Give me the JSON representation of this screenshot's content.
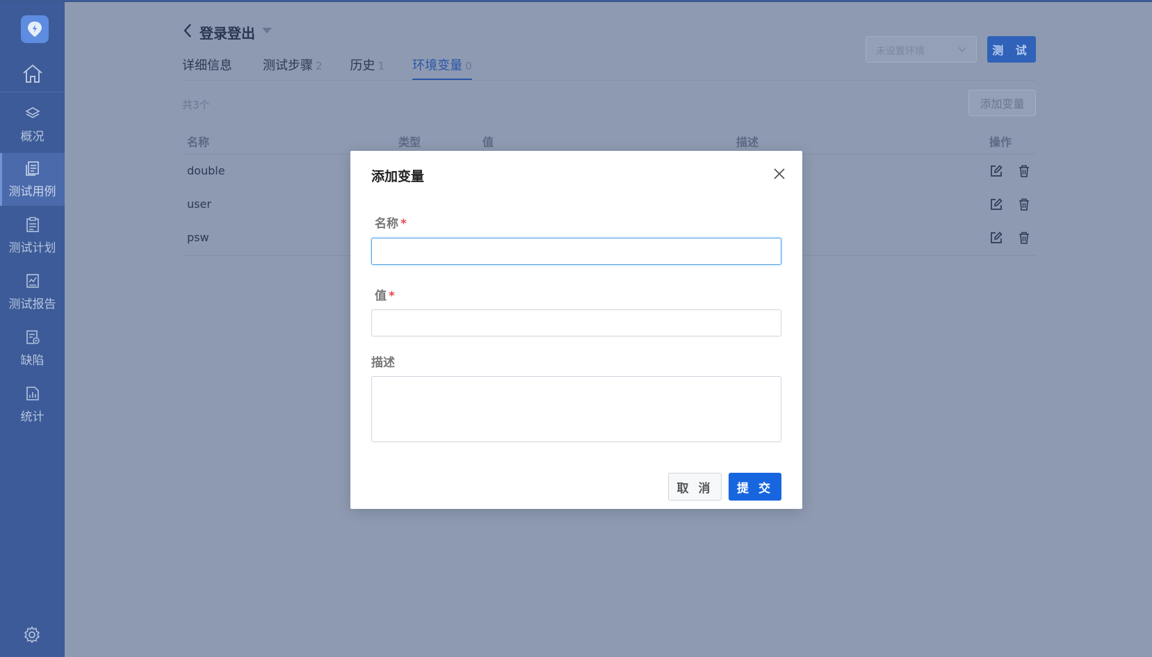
{
  "sidebar": {
    "items": [
      {
        "label": "概况",
        "icon": "layers-icon"
      },
      {
        "label": "测试用例",
        "icon": "document-list-icon",
        "active": true
      },
      {
        "label": "测试计划",
        "icon": "clipboard-icon"
      },
      {
        "label": "测试报告",
        "icon": "report-chart-icon"
      },
      {
        "label": "缺陷",
        "icon": "bug-document-icon"
      },
      {
        "label": "统计",
        "icon": "statistics-icon"
      }
    ]
  },
  "header": {
    "title": "登录登出",
    "env_placeholder": "未设置环境",
    "test_button": "测 试"
  },
  "tabs": [
    {
      "label": "详细信息",
      "count": ""
    },
    {
      "label": "测试步骤",
      "count": "2"
    },
    {
      "label": "历史",
      "count": "1"
    },
    {
      "label": "环境变量",
      "count": "0",
      "active": true
    }
  ],
  "variables": {
    "total": "共3个",
    "add_button": "添加变量",
    "columns": [
      "名称",
      "类型",
      "值",
      "描述",
      "操作"
    ],
    "rows": [
      {
        "name": "double"
      },
      {
        "name": "user"
      },
      {
        "name": "psw"
      }
    ]
  },
  "modal": {
    "title": "添加变量",
    "name_label": "名称",
    "value_label": "值",
    "required_mark": "*",
    "desc_label": "描述",
    "name_value": "",
    "value_value": "",
    "desc_value": "",
    "cancel_label": "取 消",
    "submit_label": "提 交"
  },
  "colors": {
    "sidebar_bg": "#3c5b98",
    "overlay_bg": "#8e9ab1",
    "primary": "#1766e0",
    "required": "#e5484d"
  }
}
